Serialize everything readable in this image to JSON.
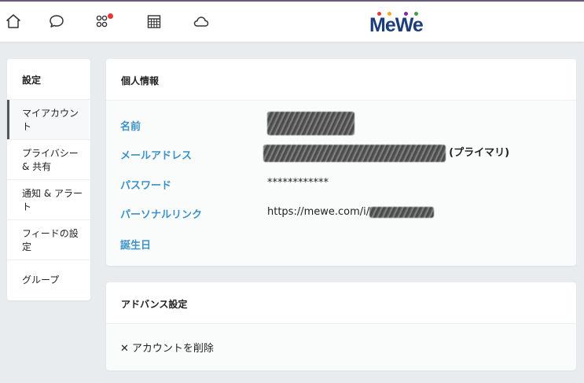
{
  "topbar": {
    "icons": [
      "home-icon",
      "chat-icon",
      "groups-icon",
      "calendar-icon",
      "cloud-icon"
    ],
    "notification_color": "#e53935",
    "logo": {
      "text": "MeWe",
      "dot_colors": [
        "#e53935",
        "#f9a825",
        "#8e24aa",
        "#43a047"
      ]
    }
  },
  "sidebar": {
    "title": "設定",
    "items": [
      {
        "label": "マイアカウント",
        "active": true
      },
      {
        "label": "プライバシー & 共有",
        "active": false
      },
      {
        "label": "通知 & アラート",
        "active": false
      },
      {
        "label": "フィードの設定",
        "active": false
      },
      {
        "label": "グループ",
        "active": false
      }
    ]
  },
  "personal_info": {
    "title": "個人情報",
    "name_label": "名前",
    "email_label": "メールアドレス",
    "email_suffix": "(プライマリ)",
    "password_label": "パスワード",
    "password_value": "************",
    "link_label": "パーソナルリンク",
    "link_prefix": "https://mewe.com/i/",
    "birthday_label": "誕生日"
  },
  "advanced": {
    "title": "アドバンス設定",
    "delete_label": "アカウントを削除"
  },
  "colors": {
    "accent": "#3c92c9",
    "background": "#e9ecef",
    "logo_blue": "#1b3d7a"
  }
}
